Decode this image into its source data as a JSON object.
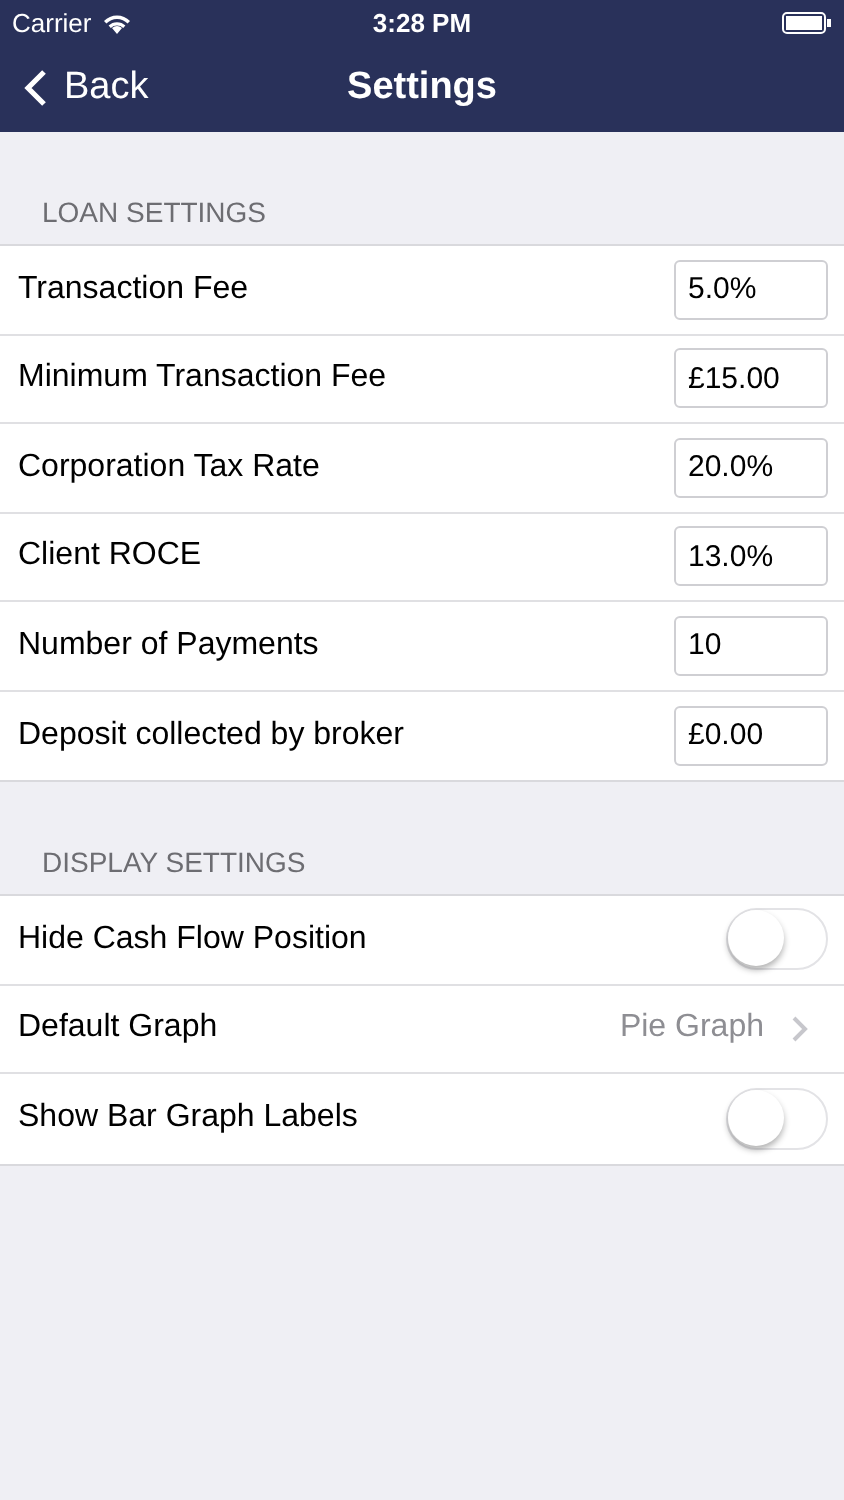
{
  "status_bar": {
    "carrier": "Carrier",
    "time": "3:28 PM"
  },
  "nav": {
    "back": "Back",
    "title": "Settings"
  },
  "sections": [
    {
      "header": "LOAN SETTINGS",
      "rows": [
        {
          "kind": "field",
          "label": "Transaction Fee",
          "value": "5.0%"
        },
        {
          "kind": "field",
          "label": "Minimum Transaction Fee",
          "value": "£15.00"
        },
        {
          "kind": "field",
          "label": "Corporation Tax Rate",
          "value": "20.0%"
        },
        {
          "kind": "field",
          "label": "Client ROCE",
          "value": "13.0%"
        },
        {
          "kind": "field",
          "label": "Number of Payments",
          "value": "10"
        },
        {
          "kind": "field",
          "label": "Deposit collected by broker",
          "value": "£0.00"
        }
      ]
    },
    {
      "header": "DISPLAY SETTINGS",
      "rows": [
        {
          "kind": "toggle",
          "label": "Hide Cash Flow Position",
          "on": false
        },
        {
          "kind": "disclosure",
          "label": "Default Graph",
          "value": "Pie Graph"
        },
        {
          "kind": "toggle",
          "label": "Show Bar Graph Labels",
          "on": false
        }
      ]
    }
  ]
}
